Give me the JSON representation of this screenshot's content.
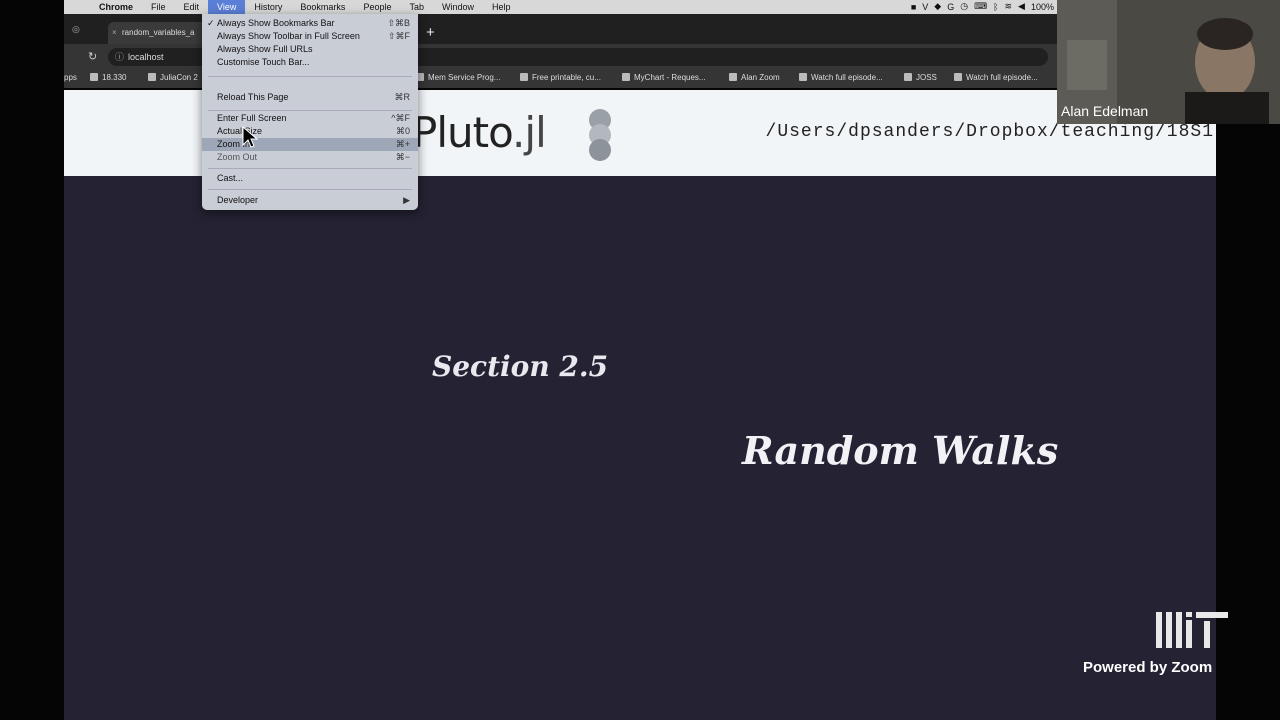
{
  "menubar": {
    "items": [
      {
        "label": "Chrome",
        "bold": true
      },
      {
        "label": "File"
      },
      {
        "label": "Edit"
      },
      {
        "label": "View",
        "active": true
      },
      {
        "label": "History"
      },
      {
        "label": "Bookmarks"
      },
      {
        "label": "People"
      },
      {
        "label": "Tab"
      },
      {
        "label": "Window"
      },
      {
        "label": "Help"
      }
    ],
    "battery": "100%"
  },
  "tabs": {
    "active_title": "random_variables_a",
    "new_tab": "+"
  },
  "address": {
    "url": "localhost"
  },
  "bookmarks": [
    "pps",
    "18.330",
    "JuliaCon 2",
    "Mem Service Prog...",
    "Free printable, cu...",
    "MyChart - Reques...",
    "Alan Zoom",
    "Watch full episode...",
    "JOSS",
    "Watch full episode..."
  ],
  "pluto": {
    "logo": "Pluto",
    "logo_suffix": ".jl",
    "path": "/Users/dpsanders/Dropbox/teaching/18S1"
  },
  "notebook": {
    "section": "Section 2.5",
    "title": "Random Walks"
  },
  "view_menu": {
    "items": [
      {
        "label": "Always Show Bookmarks Bar",
        "shortcut": "⇧⌘B",
        "checked": true
      },
      {
        "label": "Always Show Toolbar in Full Screen",
        "shortcut": "⇧⌘F"
      },
      {
        "label": "Always Show Full URLs",
        "shortcut": ""
      },
      {
        "label": "Customise Touch Bar...",
        "shortcut": ""
      },
      {
        "label": "Reload This Page",
        "shortcut": "⌘R"
      },
      {
        "label": "Enter Full Screen",
        "shortcut": "^⌘F"
      },
      {
        "label": "Actual Size",
        "shortcut": "⌘0"
      },
      {
        "label": "Zoom In",
        "shortcut": "⌘+",
        "highlighted": true
      },
      {
        "label": "Zoom Out",
        "shortcut": "⌘−"
      },
      {
        "label": "Cast...",
        "shortcut": ""
      },
      {
        "label": "Developer",
        "shortcut": "▶"
      }
    ]
  },
  "zoom": {
    "participant": "Alan Edelman",
    "powered_by": "Powered by Zoom"
  },
  "colors": {
    "notebook_bg": "#252233",
    "header_bg": "#f2f5f8",
    "menu_highlight": "#5a7fd6"
  }
}
